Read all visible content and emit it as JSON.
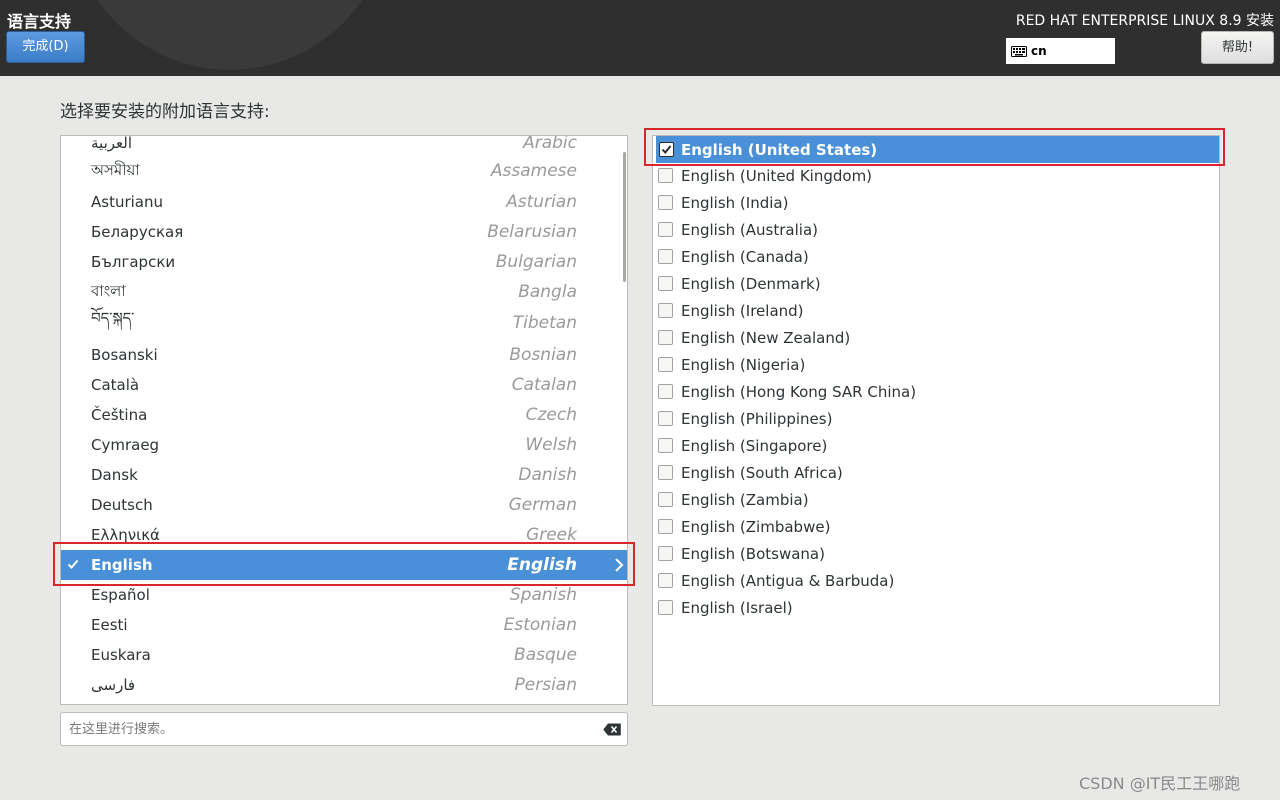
{
  "header": {
    "spoke_title": "语言支持",
    "done_button": "完成(D)",
    "product_title": "RED HAT ENTERPRISE LINUX 8.9 安装",
    "keyboard_layout": "cn",
    "help_button": "帮助!"
  },
  "prompt": "选择要安装的附加语言支持:",
  "languages": [
    {
      "native": "العربية",
      "english": "Arabic"
    },
    {
      "native": "অসমীয়া",
      "english": "Assamese"
    },
    {
      "native": "Asturianu",
      "english": "Asturian"
    },
    {
      "native": "Беларуская",
      "english": "Belarusian"
    },
    {
      "native": "Български",
      "english": "Bulgarian"
    },
    {
      "native": "বাংলা",
      "english": "Bangla"
    },
    {
      "native": "བོད་སྐད་",
      "english": "Tibetan"
    },
    {
      "native": "Bosanski",
      "english": "Bosnian"
    },
    {
      "native": "Català",
      "english": "Catalan"
    },
    {
      "native": "Čeština",
      "english": "Czech"
    },
    {
      "native": "Cymraeg",
      "english": "Welsh"
    },
    {
      "native": "Dansk",
      "english": "Danish"
    },
    {
      "native": "Deutsch",
      "english": "German"
    },
    {
      "native": "Ελληνικά",
      "english": "Greek"
    },
    {
      "native": "English",
      "english": "English",
      "selected": true
    },
    {
      "native": "Español",
      "english": "Spanish"
    },
    {
      "native": "Eesti",
      "english": "Estonian"
    },
    {
      "native": "Euskara",
      "english": "Basque"
    },
    {
      "native": "فارسی",
      "english": "Persian"
    }
  ],
  "search": {
    "placeholder": "在这里进行搜索。",
    "value": ""
  },
  "locales": [
    {
      "label": "English (United States)",
      "checked": true
    },
    {
      "label": "English (United Kingdom)",
      "checked": false
    },
    {
      "label": "English (India)",
      "checked": false
    },
    {
      "label": "English (Australia)",
      "checked": false
    },
    {
      "label": "English (Canada)",
      "checked": false
    },
    {
      "label": "English (Denmark)",
      "checked": false
    },
    {
      "label": "English (Ireland)",
      "checked": false
    },
    {
      "label": "English (New Zealand)",
      "checked": false
    },
    {
      "label": "English (Nigeria)",
      "checked": false
    },
    {
      "label": "English (Hong Kong SAR China)",
      "checked": false
    },
    {
      "label": "English (Philippines)",
      "checked": false
    },
    {
      "label": "English (Singapore)",
      "checked": false
    },
    {
      "label": "English (South Africa)",
      "checked": false
    },
    {
      "label": "English (Zambia)",
      "checked": false
    },
    {
      "label": "English (Zimbabwe)",
      "checked": false
    },
    {
      "label": "English (Botswana)",
      "checked": false
    },
    {
      "label": "English (Antigua & Barbuda)",
      "checked": false
    },
    {
      "label": "English (Israel)",
      "checked": false
    }
  ],
  "watermark": "CSDN @IT民工王哪跑",
  "colors": {
    "header_bg": "#2f2f2f",
    "selection": "#4a90d9",
    "annotation": "#d9252c"
  }
}
